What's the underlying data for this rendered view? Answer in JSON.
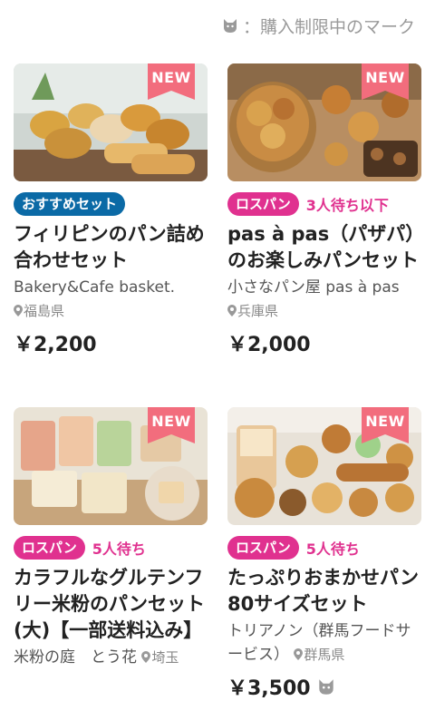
{
  "legend": {
    "icon": "cat-icon",
    "text": "：購入制限中のマーク"
  },
  "colors": {
    "accent_pink": "#e0318f",
    "accent_blue": "#0b6aa6",
    "new_badge": "#f26d7d"
  },
  "products": [
    {
      "badge": "NEW",
      "tag": "おすすめセット",
      "tag_color": "blue",
      "wait": "",
      "title": "フィリピンのパン詰め合わせセット",
      "shop": "Bakery&Cafe basket.",
      "location": "福島県",
      "price": "￥2,200",
      "purchase_limited": false
    },
    {
      "badge": "NEW",
      "tag": "ロスパン",
      "tag_color": "pink",
      "wait": "3人待ち以下",
      "title": "pas à pas（パザパ）のお楽しみパンセット",
      "shop": "小さなパン屋 pas à pas",
      "location": "兵庫県",
      "price": "￥2,000",
      "purchase_limited": false
    },
    {
      "badge": "NEW",
      "tag": "ロスパン",
      "tag_color": "pink",
      "wait": "5人待ち",
      "title": "カラフルなグルテンフリー米粉のパンセット(大)【一部送料込み】",
      "shop": "米粉の庭　とう花",
      "location": "埼玉",
      "price": "",
      "purchase_limited": false
    },
    {
      "badge": "NEW",
      "tag": "ロスパン",
      "tag_color": "pink",
      "wait": "5人待ち",
      "title": "たっぷりおまかせパン80サイズセット",
      "shop": "トリアノン（群馬フードサービス）",
      "location": "群馬県",
      "price": "￥3,500",
      "purchase_limited": true
    }
  ]
}
